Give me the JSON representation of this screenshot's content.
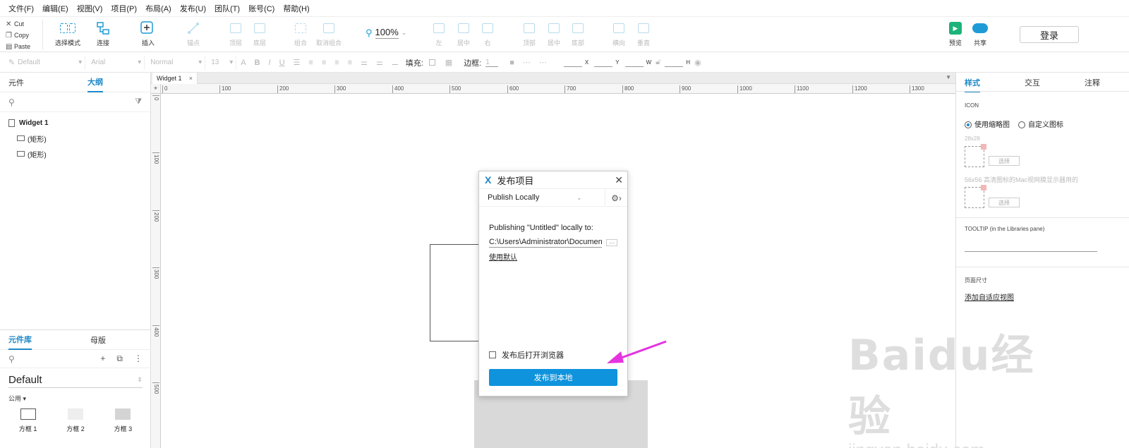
{
  "menu": [
    "文件(F)",
    "编辑(E)",
    "视图(V)",
    "项目(P)",
    "布局(A)",
    "发布(U)",
    "团队(T)",
    "账号(C)",
    "帮助(H)"
  ],
  "clipboard": {
    "cut": "Cut",
    "copy": "Copy",
    "paste": "Paste"
  },
  "toolbar": {
    "select_mode": "选择模式",
    "connect": "连接",
    "insert": "插入",
    "anchor": "锚点",
    "top": "顶层",
    "bottom": "底层",
    "group": "组合",
    "ungroup": "取消组合",
    "left": "左",
    "center": "居中",
    "right": "右",
    "align_top": "顶部",
    "middle": "居中",
    "align_bottom": "底部",
    "horizontal": "横向",
    "vertical": "垂直",
    "zoom": "100%",
    "preview": "预览",
    "share": "共享",
    "login": "登录"
  },
  "format": {
    "style": "Default",
    "font": "Arial",
    "weight": "Normal",
    "size": "13",
    "fill_label": "填充:",
    "border_label": "边框:",
    "border_value": "1",
    "x": "X",
    "y": "Y",
    "w": "W",
    "h": "H"
  },
  "left_top": {
    "tab_components": "元件",
    "tab_outline": "大纲",
    "page": "Widget 1",
    "items": [
      "(矩形)",
      "(矩形)"
    ]
  },
  "library": {
    "tab_library": "元件库",
    "tab_masters": "母版",
    "selected": "Default",
    "category": "公用 ▾",
    "shapes": [
      "方框 1",
      "方框 2",
      "方框 3"
    ]
  },
  "canvas": {
    "tab": "Widget 1",
    "h_ticks": [
      "0",
      "100",
      "200",
      "300",
      "400",
      "500",
      "600",
      "700",
      "800",
      "900",
      "1000",
      "1100",
      "1200",
      "1300"
    ],
    "v_ticks": [
      "0",
      "100",
      "200",
      "300",
      "400",
      "500"
    ]
  },
  "dialog": {
    "title": "发布项目",
    "mode": "Publish Locally",
    "publishing_to": "Publishing \"Untitled\" locally to:",
    "path": "C:\\Users\\Administrator\\Documents",
    "use_default": "使用默认",
    "open_browser": "发布后打开浏览器",
    "publish_button": "发布到本地"
  },
  "right": {
    "tab_style": "样式",
    "tab_interaction": "交互",
    "tab_notes": "注释",
    "icon_label": "ICON",
    "use_thumbnail": "使用缩略图",
    "custom_icon": "自定义图标",
    "size1": "28x28",
    "size2_desc": "56x56 高清图标的Mac视网膜显示器用的",
    "select": "选择",
    "tooltip_label": "TOOLTIP (in the Libraries pane)",
    "page_size": "页面尺寸",
    "add_adaptive": "添加自适应视图"
  },
  "watermark": {
    "brand": "Baidu经验",
    "url": "jingyan.baidu.com"
  }
}
